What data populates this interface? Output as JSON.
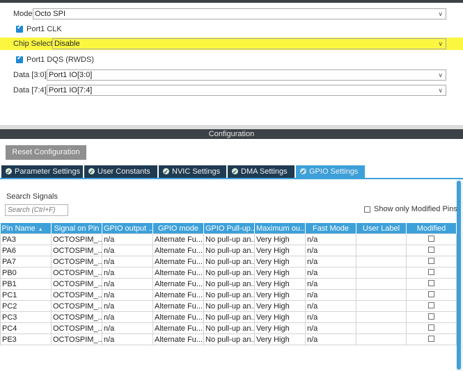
{
  "mode_section": {
    "mode": {
      "label": "Mode",
      "value": "Octo SPI"
    },
    "port1_clk": {
      "label": "Port1 CLK",
      "checked": true
    },
    "chip_select": {
      "label": "Chip Select",
      "value": "Disable",
      "highlight_color": "#fbf741"
    },
    "port1_dqs": {
      "label": "Port1 DQS (RWDS)",
      "checked": true
    },
    "data_3_0": {
      "label": "Data [3:0]",
      "value": "Port1 IO[3:0]"
    },
    "data_7_4": {
      "label": "Data [7:4]",
      "value": "Port1 IO[7:4]"
    }
  },
  "configuration": {
    "title": "Configuration",
    "reset_button": "Reset Configuration",
    "tabs": [
      {
        "label": "Parameter Settings",
        "active": false
      },
      {
        "label": "User Constants",
        "active": false
      },
      {
        "label": "NVIC Settings",
        "active": false
      },
      {
        "label": "DMA Settings",
        "active": false
      },
      {
        "label": "GPIO Settings",
        "active": true
      }
    ]
  },
  "gpio": {
    "search_title": "Search Signals",
    "search_placeholder": "Search (Ctrl+F)",
    "show_modified_label": "Show only Modified Pins",
    "show_modified_checked": false,
    "columns": [
      "Pin Name",
      "Signal on Pin",
      "GPIO output ...",
      "GPIO mode",
      "GPIO Pull-up...",
      "Maximum ou...",
      "Fast Mode",
      "User Label",
      "Modified"
    ],
    "rows": [
      {
        "pin": "PA3",
        "signal": "OCTOSPIM_...",
        "output": "n/a",
        "mode": "Alternate Fu...",
        "pull": "No pull-up an...",
        "speed": "Very High",
        "fast": "n/a",
        "label": "",
        "modified": false
      },
      {
        "pin": "PA6",
        "signal": "OCTOSPIM_...",
        "output": "n/a",
        "mode": "Alternate Fu...",
        "pull": "No pull-up an...",
        "speed": "Very High",
        "fast": "n/a",
        "label": "",
        "modified": false
      },
      {
        "pin": "PA7",
        "signal": "OCTOSPIM_...",
        "output": "n/a",
        "mode": "Alternate Fu...",
        "pull": "No pull-up an...",
        "speed": "Very High",
        "fast": "n/a",
        "label": "",
        "modified": false
      },
      {
        "pin": "PB0",
        "signal": "OCTOSPIM_...",
        "output": "n/a",
        "mode": "Alternate Fu...",
        "pull": "No pull-up an...",
        "speed": "Very High",
        "fast": "n/a",
        "label": "",
        "modified": false
      },
      {
        "pin": "PB1",
        "signal": "OCTOSPIM_...",
        "output": "n/a",
        "mode": "Alternate Fu...",
        "pull": "No pull-up an...",
        "speed": "Very High",
        "fast": "n/a",
        "label": "",
        "modified": false
      },
      {
        "pin": "PC1",
        "signal": "OCTOSPIM_...",
        "output": "n/a",
        "mode": "Alternate Fu...",
        "pull": "No pull-up an...",
        "speed": "Very High",
        "fast": "n/a",
        "label": "",
        "modified": false
      },
      {
        "pin": "PC2",
        "signal": "OCTOSPIM_...",
        "output": "n/a",
        "mode": "Alternate Fu...",
        "pull": "No pull-up an...",
        "speed": "Very High",
        "fast": "n/a",
        "label": "",
        "modified": false
      },
      {
        "pin": "PC3",
        "signal": "OCTOSPIM_...",
        "output": "n/a",
        "mode": "Alternate Fu...",
        "pull": "No pull-up an...",
        "speed": "Very High",
        "fast": "n/a",
        "label": "",
        "modified": false
      },
      {
        "pin": "PC4",
        "signal": "OCTOSPIM_...",
        "output": "n/a",
        "mode": "Alternate Fu...",
        "pull": "No pull-up an...",
        "speed": "Very High",
        "fast": "n/a",
        "label": "",
        "modified": false
      },
      {
        "pin": "PE3",
        "signal": "OCTOSPIM_...",
        "output": "n/a",
        "mode": "Alternate Fu...",
        "pull": "No pull-up an...",
        "speed": "Very High",
        "fast": "n/a",
        "label": "",
        "modified": false
      }
    ]
  },
  "colors": {
    "accent": "#3da0d9",
    "dark_header": "#3c4147",
    "tab_dark": "#1f3b52",
    "highlight": "#fbf741"
  }
}
